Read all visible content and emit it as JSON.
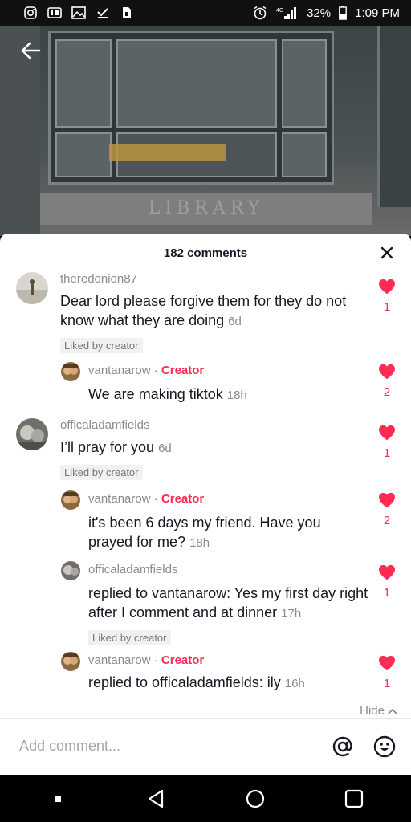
{
  "status_bar": {
    "battery": "32%",
    "time": "1:09 PM",
    "network": "4G"
  },
  "video": {
    "sign_text": "LIBRARY"
  },
  "comments_sheet": {
    "title": "182 comments",
    "comments": [
      {
        "username": "theredonion87",
        "text": "Dear lord please forgive them for they do not know what they are doing",
        "time": "6d",
        "liked_by_creator": "Liked by creator",
        "likes": "1"
      },
      {
        "username": "vantanarow",
        "creator_badge": "Creator",
        "text": "We are making tiktok",
        "time": "18h",
        "likes": "2"
      },
      {
        "username": "officaladamfields",
        "text": "I’ll pray for you",
        "time": "6d",
        "liked_by_creator": "Liked by creator",
        "likes": "1"
      },
      {
        "username": "vantanarow",
        "creator_badge": "Creator",
        "text": "it's been 6 days my friend. Have you prayed for me?",
        "time": "18h",
        "likes": "2"
      },
      {
        "username": "officaladamfields",
        "text": "replied to vantanarow: Yes my first day right after I comment and at dinner",
        "time": "17h",
        "liked_by_creator": "Liked by creator",
        "likes": "1"
      },
      {
        "username": "vantanarow",
        "creator_badge": "Creator",
        "text": "replied to officaladamfields: ily",
        "time": "16h",
        "likes": "1"
      }
    ],
    "separator": "·",
    "hide_label": "Hide",
    "add_comment_placeholder": "Add comment..."
  },
  "colors": {
    "accent": "#fe2c55",
    "text_primary": "#161823",
    "text_secondary": "#8a8b91"
  },
  "icons": [
    "back-arrow-icon",
    "close-icon",
    "heart-icon",
    "chevron-up-icon",
    "at-mention-icon",
    "emoji-icon",
    "nav-back-icon",
    "nav-home-icon",
    "nav-recents-icon"
  ]
}
